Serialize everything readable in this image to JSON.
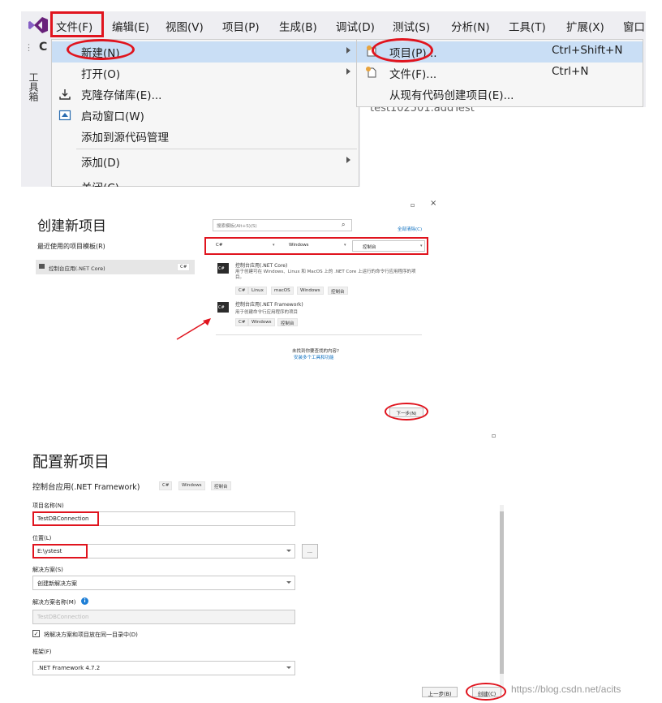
{
  "menu": {
    "items": [
      "文件(F)",
      "编辑(E)",
      "视图(V)",
      "项目(P)",
      "生成(B)",
      "调试(D)",
      "测试(S)",
      "分析(N)",
      "工具(T)",
      "扩展(X)",
      "窗口"
    ],
    "toolbox_label": "工具箱",
    "toolbar_glyph": "C"
  },
  "file_menu": {
    "items": [
      {
        "label": "新建(N)",
        "icon": "new-icon",
        "submenu": true
      },
      {
        "label": "打开(O)",
        "icon": "",
        "submenu": true
      },
      {
        "label": "克隆存储库(E)...",
        "icon": "clone-icon",
        "submenu": false
      },
      {
        "label": "启动窗口(W)",
        "icon": "start-window-icon",
        "submenu": false
      },
      {
        "label": "添加到源代码管理",
        "icon": "",
        "submenu": false
      },
      {
        "label": "添加(D)",
        "icon": "",
        "submenu": true
      },
      {
        "label": "关闭(C)",
        "icon": "",
        "submenu": false
      }
    ]
  },
  "new_submenu": {
    "items": [
      {
        "label": "项目(P)...",
        "shortcut": "Ctrl+Shift+N"
      },
      {
        "label": "文件(F)...",
        "shortcut": "Ctrl+N"
      },
      {
        "label": "从现有代码创建项目(E)...",
        "shortcut": ""
      }
    ],
    "background_text": "test102501.addTest"
  },
  "create_project": {
    "title": "创建新项目",
    "recent_heading": "最近使用的项目模板(R)",
    "recent_item": "控制台应用(.NET Core)",
    "recent_item_lang": "C#",
    "search_placeholder": "搜索模板(Alt+S)(S)",
    "clear_all": "全部清除(C)",
    "filters": {
      "language": "C#",
      "platform": "Windows",
      "type": "控制台"
    },
    "templates": [
      {
        "name": "控制台应用(.NET Core)",
        "desc": "用于创建可在 Windows、Linux 和 MacOS 上的 .NET Core 上运行的命令行应用程序的项目。",
        "tags": [
          "C#",
          "Linux",
          "macOS",
          "Windows",
          "控制台"
        ]
      },
      {
        "name": "控制台应用(.NET Framework)",
        "desc": "用于创建命令行应用程序的项目",
        "tags": [
          "C#",
          "Windows",
          "控制台"
        ]
      }
    ],
    "not_found": "未找到你要查找的内容?",
    "install_link": "安装多个工具和功能",
    "next_button": "下一步(N)",
    "window_controls": [
      "▫",
      "×"
    ]
  },
  "configure_project": {
    "title": "配置新项目",
    "template_name": "控制台应用(.NET Framework)",
    "tags": [
      "C#",
      "Windows",
      "控制台"
    ],
    "project_name_label": "项目名称(N)",
    "project_name": "TestDBConnection",
    "location_label": "位置(L)",
    "location": "E:\\ystest",
    "browse_label": "...",
    "solution_label": "解决方案(S)",
    "solution": "创建新解决方案",
    "solution_name_label": "解决方案名称(M)",
    "solution_name_placeholder": "TestDBConnection",
    "same_dir_label": "将解决方案和项目放在同一目录中(D)",
    "framework_label": "框架(F)",
    "framework": ".NET Framework 4.7.2",
    "back_button": "上一步(B)",
    "create_button": "创建(C)",
    "window_control": "▫"
  },
  "watermark": "https://blog.csdn.net/acits",
  "colors": {
    "highlight": "#c9def5",
    "annotation_red": "#e0141e",
    "vs_purple": "#68217a",
    "link_blue": "#0e70c0",
    "info_blue": "#1e7fd6"
  }
}
